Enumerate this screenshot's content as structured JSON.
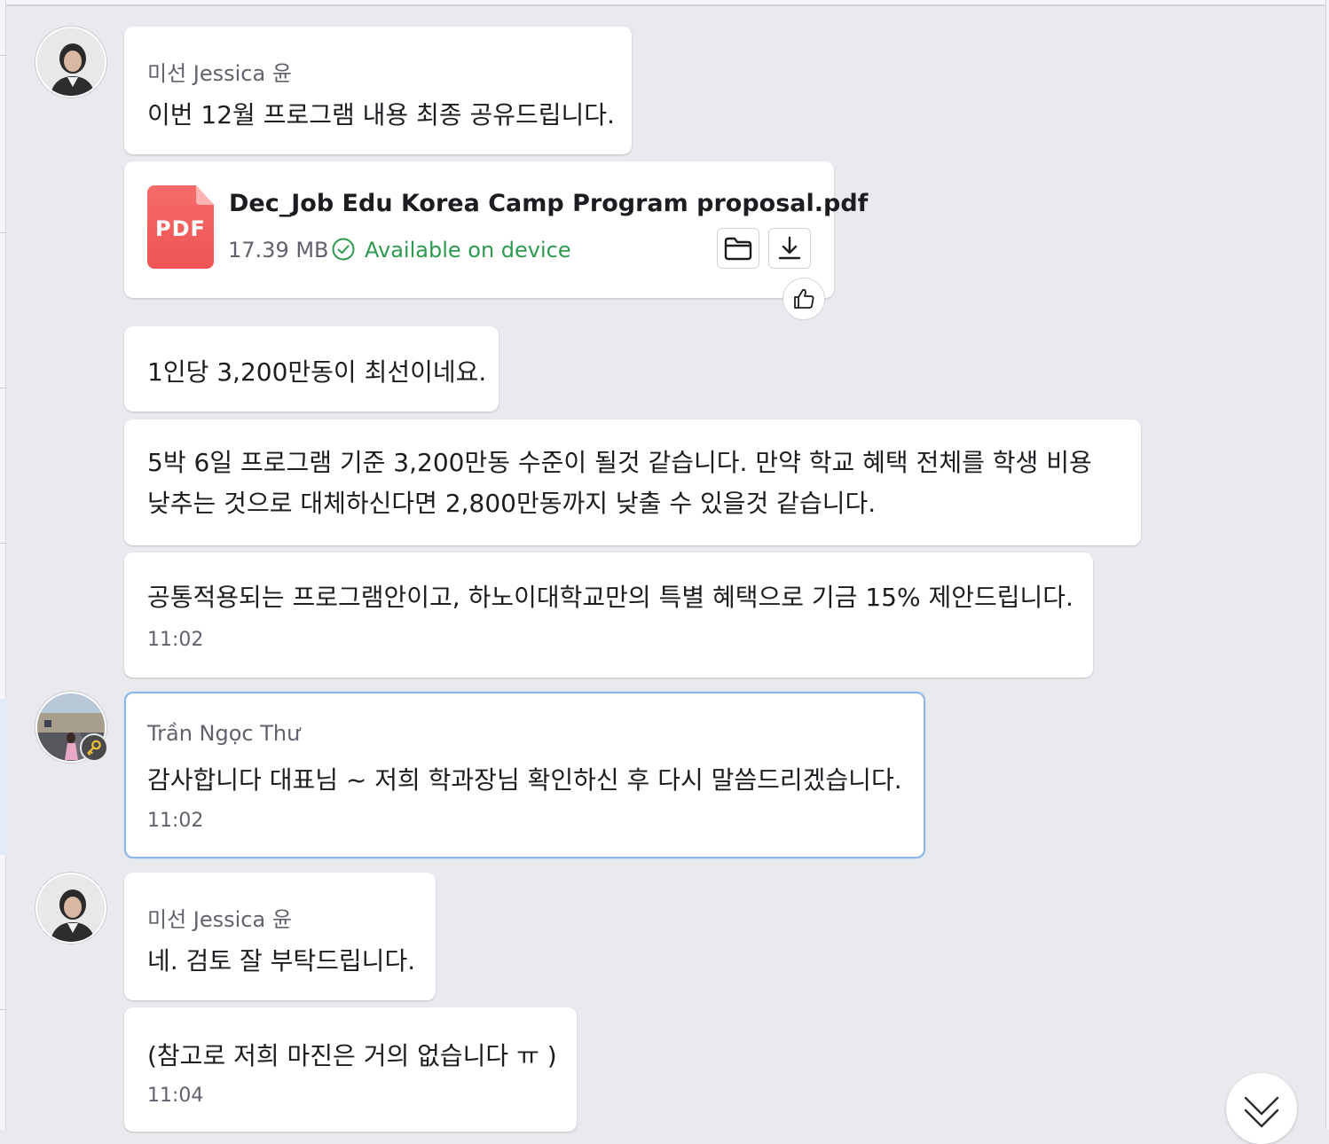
{
  "colors": {
    "background": "#e9eaee",
    "bubble": "#ffffff",
    "selected_border": "#8fb4ea",
    "pdf_red": "#ee5454",
    "available_green": "#2e9a4f"
  },
  "messages": {
    "m1": {
      "sender": "미선 Jessica 윤",
      "text": "이번 12월 프로그램 내용 최종 공유드립니다."
    },
    "file": {
      "icon": "pdf-file-icon",
      "type_label": "PDF",
      "name": "Dec_Job Edu Korea Camp Program proposal.pdf",
      "size": "17.39 MB",
      "status": "Available on device",
      "status_icon": "check-circle-icon",
      "actions": [
        "folder-icon",
        "download-icon"
      ],
      "reaction_icon": "thumbs-up-icon"
    },
    "m2": {
      "text": "1인당 3,200만동이 최선이네요."
    },
    "m3": {
      "text": "5박 6일 프로그램 기준 3,200만동 수준이 될것 같습니다. 만약 학교 혜택 전체를 학생 비용 낮추는 것으로 대체하신다면 2,800만동까지 낮출 수 있을것 같습니다."
    },
    "m4": {
      "text": "공통적용되는 프로그램안이고, 하노이대학교만의 특별 혜택으로 기금 15% 제안드립니다.",
      "time": "11:02"
    },
    "m5": {
      "sender": "Trần Ngọc Thư",
      "text": "감사합니다 대표님 ~ 저희 학과장님 확인하신 후 다시 말씀드리겠습니다.",
      "time": "11:02",
      "badge_icon": "key-icon"
    },
    "m6": {
      "sender": "미선 Jessica 윤",
      "text": "네. 검토 잘 부탁드립니다."
    },
    "m7": {
      "text": "(참고로 저희 마진은 거의 없습니다 ㅠ )",
      "time": "11:04"
    }
  },
  "scroll_button_icon": "chevron-double-down-icon"
}
